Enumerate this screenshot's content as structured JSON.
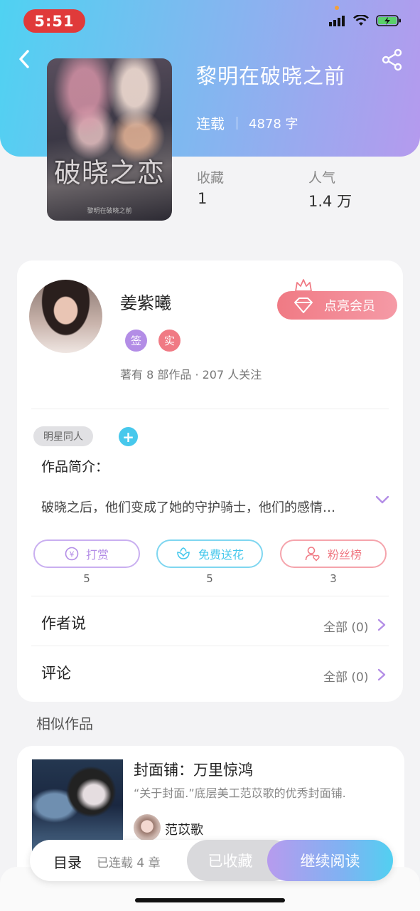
{
  "status_bar": {
    "time": "5:51"
  },
  "book": {
    "title": "黎明在破晓之前",
    "status": "连载",
    "word_count": "4878 字",
    "cover_title": "破晓之恋",
    "cover_small_text": "黎明在破晓之前"
  },
  "stats": [
    {
      "label": "收藏",
      "value": "1"
    },
    {
      "label": "人气",
      "value": "1.4 万"
    }
  ],
  "author": {
    "name": "姜紫曦",
    "badges": [
      {
        "text": "签",
        "color": "#b38de6"
      },
      {
        "text": "实",
        "color": "#f07a84"
      }
    ],
    "info": "著有 8 部作品 · 207 人关注",
    "vip_label": "点亮会员"
  },
  "tag": "明星同人",
  "intro": {
    "label": "作品简介：",
    "text": "破晓之后，他们变成了她的守护骑士，他们的感情…"
  },
  "actions": [
    {
      "label": "打赏",
      "count": "5",
      "color": "#b38de6"
    },
    {
      "label": "免费送花",
      "count": "5",
      "color": "#47c8ec"
    },
    {
      "label": "粉丝榜",
      "count": "3",
      "color": "#f07a84"
    }
  ],
  "rows": [
    {
      "label": "作者说",
      "right": "全部 (0)"
    },
    {
      "label": "评论",
      "right": "全部 (0)"
    }
  ],
  "similar": {
    "section_title": "相似作品",
    "item": {
      "title": "封面铺：万里惊鸿",
      "desc": "“关于封面.”底层美工范苡歌的优秀封面铺.",
      "author": "范苡歌"
    }
  },
  "bottom_bar": {
    "toc_label": "目录",
    "toc_count": "已连载 4 章",
    "collected_label": "已收藏",
    "read_label": "继续阅读"
  },
  "colors": {
    "header_gradient_start": "#4fd2f2",
    "header_gradient_end": "#b59aee",
    "accent_purple": "#b38de6",
    "accent_cyan": "#47c8ec",
    "accent_pink": "#f07a84"
  }
}
